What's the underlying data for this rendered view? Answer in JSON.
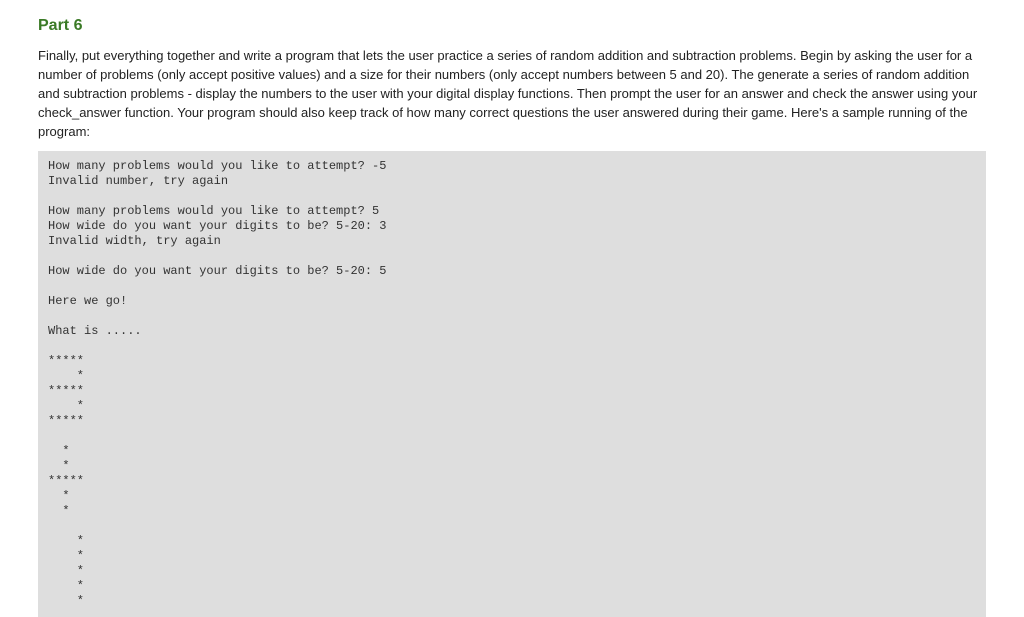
{
  "heading": "Part 6",
  "intro": "Finally, put everything together and write a program that lets the user practice a series of random addition and subtraction problems. Begin by asking the user for a number of problems (only accept positive values) and a size for their numbers (only accept numbers between 5 and 20). The generate a series of random addition and subtraction problems - display the numbers to the user with your digital display functions. Then prompt the user for an answer and check the answer using your check_answer function. Your program should also keep track of how many correct questions the user answered during their game. Here's a sample running of the program:",
  "sample_output": "How many problems would you like to attempt? -5\nInvalid number, try again\n\nHow many problems would you like to attempt? 5\nHow wide do you want your digits to be? 5-20: 3\nInvalid width, try again\n\nHow wide do you want your digits to be? 5-20: 5\n\nHere we go!\n\nWhat is .....\n\n*****\n    *\n*****\n    *\n*****\n\n  *\n  *\n*****\n  *\n  *\n\n    *\n    *\n    *\n    *\n    *"
}
